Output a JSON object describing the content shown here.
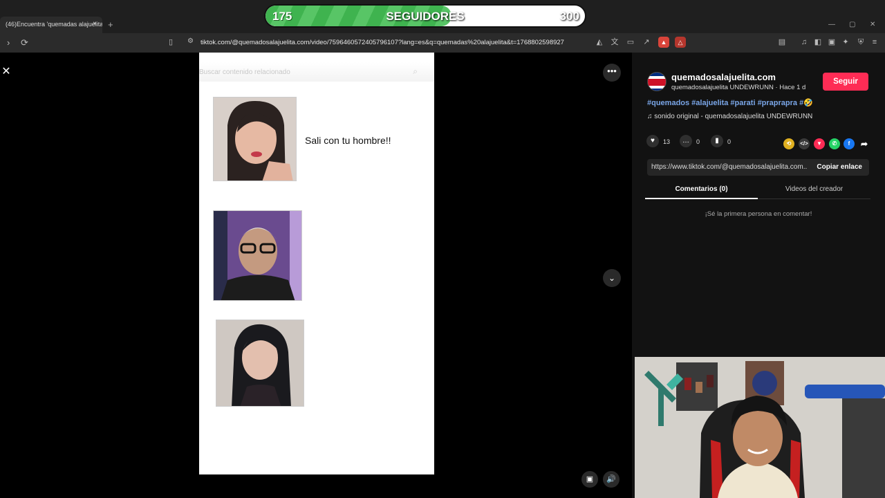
{
  "browser": {
    "tab_title": "(46)Encuentra 'quemadas alajuelita'",
    "tab_close": "×",
    "new_tab": "+",
    "url": "tiktok.com/@quemadosalajuelita.com/video/7596460572405796107?lang=es&q=quemadas%20alajuelita&t=1768802598927"
  },
  "follower_goal": {
    "current": "175",
    "label": "SEGUIDORES",
    "goal": "300",
    "progress_fraction": 0.583
  },
  "video": {
    "search_placeholder": "Buscar contenido relacionado",
    "caption": "Sali con tu hombre!!"
  },
  "post": {
    "account": "quemadosalajuelita.com",
    "subtitle": "quemadosalajuelita UNDEWRUNN · Hace 1 d",
    "follow_label": "Seguir",
    "hashtags": "#quemados #alajuelita #parati #praprapra #🤣",
    "sound": "sonido original - quemadosalajuelita UNDEWRUNN",
    "likes": "13",
    "comments": "0",
    "saves": "0",
    "share_link": "https://www.tiktok.com/@quemadosalajuelita.com...",
    "copy_label": "Copiar enlace",
    "tab_comments": "Comentarios (0)",
    "tab_videos": "Videos del creador",
    "empty_comments": "¡Sé la primera persona en comentar!"
  },
  "colors": {
    "accent_red": "#fe2c55",
    "hashtag_blue": "#7aa6e8",
    "progress_green": "#3fb34f"
  }
}
